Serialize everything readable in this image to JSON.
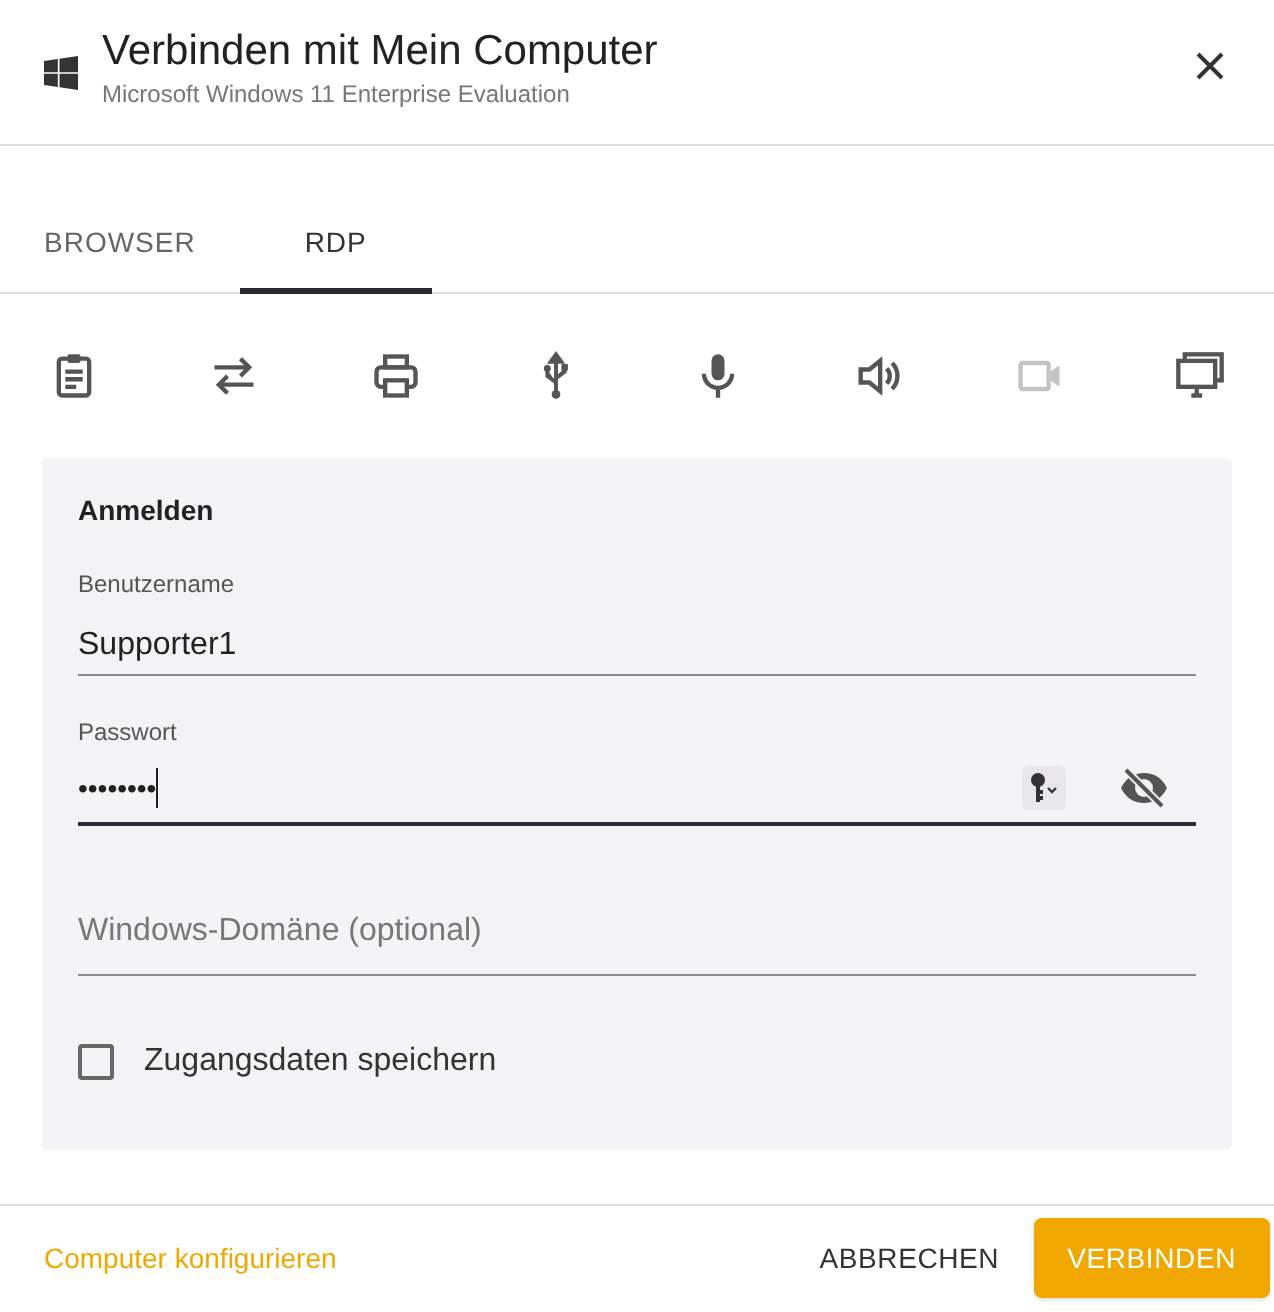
{
  "dialog": {
    "title": "Verbinden mit Mein Computer",
    "subtitle": "Microsoft Windows 11 Enterprise Evaluation"
  },
  "tabs": [
    {
      "label": "BROWSER",
      "selected": false
    },
    {
      "label": "RDP",
      "selected": true
    }
  ],
  "features": [
    {
      "kind": "clipboard",
      "disabled": false
    },
    {
      "kind": "transfer",
      "disabled": false
    },
    {
      "kind": "printer",
      "disabled": false
    },
    {
      "kind": "usb",
      "disabled": false
    },
    {
      "kind": "microphone",
      "disabled": false
    },
    {
      "kind": "speaker",
      "disabled": false
    },
    {
      "kind": "camera",
      "disabled": true
    },
    {
      "kind": "monitor",
      "disabled": false
    }
  ],
  "login": {
    "heading": "Anmelden",
    "username": {
      "label": "Benutzername",
      "value": "Supporter1",
      "focused": false
    },
    "password": {
      "label": "Passwort",
      "value": "••••••••",
      "focused": true
    },
    "domain": {
      "placeholder": "Windows-Domäne (optional)",
      "focused": false
    },
    "remember": {
      "label": "Zugangsdaten speichern",
      "checked": false
    }
  },
  "footer": {
    "link": "Computer konfigurieren",
    "buttons": [
      "ABBRECHEN",
      "VERBINDEN"
    ]
  }
}
